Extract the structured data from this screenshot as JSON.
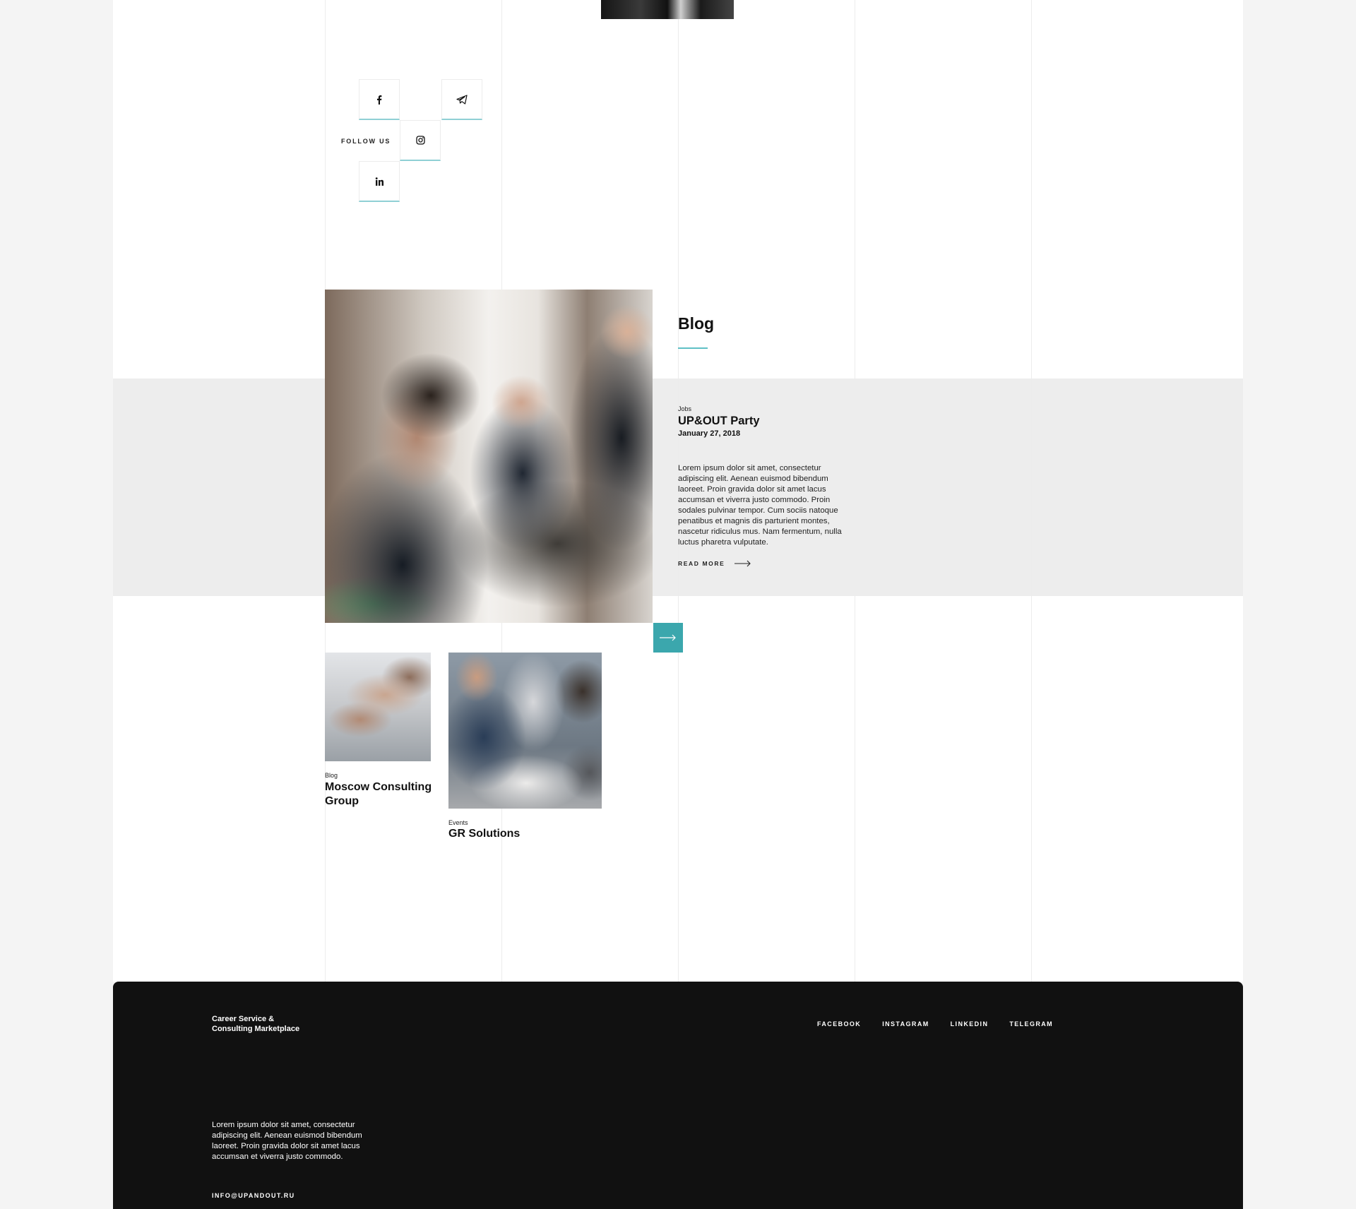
{
  "colors": {
    "accent": "#3ba7ad",
    "accent_light": "#5fc0c6",
    "band": "#ededed",
    "footer_bg": "#111111"
  },
  "follow": {
    "label": "FOLLOW US",
    "icons": [
      "facebook-icon",
      "telegram-icon",
      "instagram-icon",
      "linkedin-icon"
    ]
  },
  "blog": {
    "heading": "Blog",
    "featured": {
      "category": "Jobs",
      "title": "UP&OUT Party",
      "date": "January 27, 2018",
      "excerpt": "Lorem ipsum dolor sit amet, consectetur adipiscing elit. Aenean euismod bibendum laoreet. Proin gravida dolor sit amet lacus accumsan et viverra justo commodo. Proin sodales pulvinar tempor. Cum sociis natoque penatibus et magnis dis parturient montes, nascetur ridiculus mus. Nam fermentum, nulla luctus pharetra vulputate.",
      "read_more": "READ MORE"
    },
    "cards": [
      {
        "category": "Blog",
        "title": "Moscow Consulting Group"
      },
      {
        "category": "Events",
        "title": "GR Solutions"
      }
    ]
  },
  "footer": {
    "brand_line1": "Career Service &",
    "brand_line2": "Consulting Marketplace",
    "links": [
      "FACEBOOK",
      "INSTAGRAM",
      "LINKEDIN",
      "TELEGRAM"
    ],
    "text": "Lorem ipsum dolor sit amet, consectetur adipiscing elit. Aenean euismod bibendum laoreet. Proin gravida dolor sit amet lacus accumsan et viverra justo commodo.",
    "email": "INFO@UPANDOUT.RU"
  }
}
